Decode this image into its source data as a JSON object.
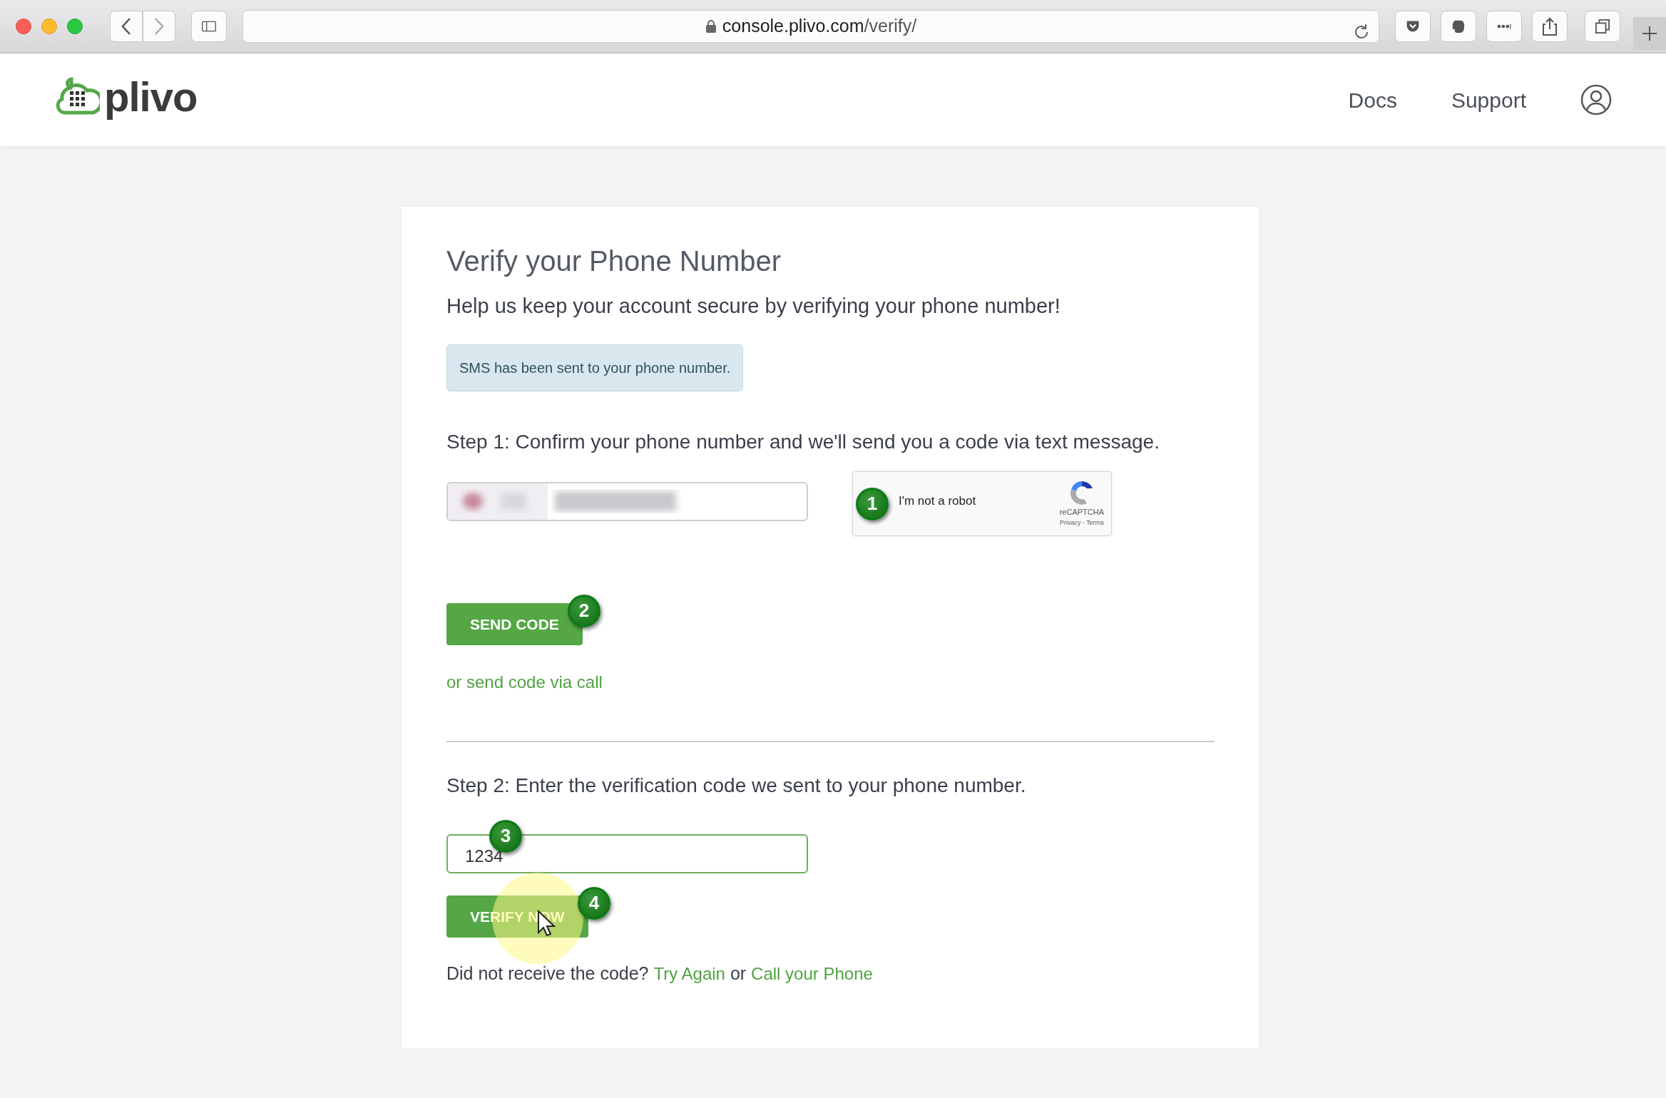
{
  "browser": {
    "url_host": "console.plivo.com",
    "url_path": "/verify/"
  },
  "header": {
    "logo": "plivo",
    "nav": [
      "Docs",
      "Support"
    ]
  },
  "card": {
    "title": "Verify your Phone Number",
    "subtitle": "Help us keep your account secure by verifying your phone number!",
    "alert": "SMS has been sent to your phone number.",
    "step1": "Step 1: Confirm your phone number and we'll send you a code via text message.",
    "captcha": {
      "label": "I'm not a robot",
      "brand": "reCAPTCHA",
      "links": "Privacy - Terms"
    },
    "send_button": "SEND CODE",
    "call_link": "or send code via call",
    "step2": "Step 2: Enter the verification code we sent to your phone number.",
    "code_value": "1234",
    "verify_button": "VERIFY NOW",
    "footer": {
      "text": "Did not receive the code?",
      "link1": "Try Again",
      "joiner": "or",
      "link2": "Call your Phone"
    }
  },
  "annotations": [
    "1",
    "2",
    "3",
    "4"
  ]
}
